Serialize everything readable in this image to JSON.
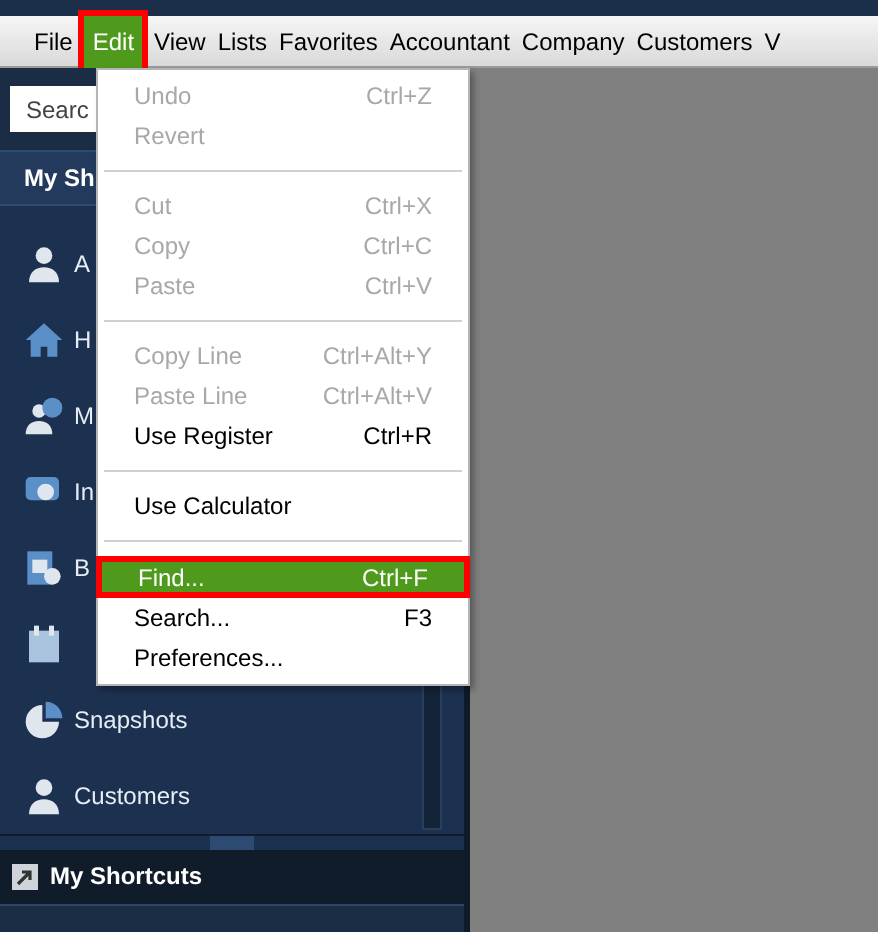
{
  "menu_bar": [
    {
      "label": "File",
      "selected": false
    },
    {
      "label": "Edit",
      "selected": true
    },
    {
      "label": "View",
      "selected": false
    },
    {
      "label": "Lists",
      "selected": false
    },
    {
      "label": "Favorites",
      "selected": false
    },
    {
      "label": "Accountant",
      "selected": false
    },
    {
      "label": "Company",
      "selected": false
    },
    {
      "label": "Customers",
      "selected": false
    },
    {
      "label": "V",
      "selected": false
    }
  ],
  "sidebar": {
    "search": {
      "placeholder": "Searc"
    },
    "header": "My Sh",
    "items": [
      {
        "kind": "person",
        "label": "A"
      },
      {
        "kind": "home",
        "label": "H"
      },
      {
        "kind": "badge-person",
        "label": "M"
      },
      {
        "kind": "chat",
        "label": "In"
      },
      {
        "kind": "document",
        "label": "B"
      },
      {
        "kind": "calendar"
      },
      {
        "kind": "pie",
        "label": "Snapshots"
      },
      {
        "kind": "person",
        "label": "Customers"
      }
    ],
    "footer": "My Shortcuts"
  },
  "edit_menu": [
    {
      "kind": "item",
      "label": "Undo",
      "shortcut": "Ctrl+Z",
      "disabled": true,
      "selected": false
    },
    {
      "kind": "item",
      "label": "Revert",
      "disabled": true,
      "selected": false
    },
    {
      "kind": "separator"
    },
    {
      "kind": "item",
      "label": "Cut",
      "shortcut": "Ctrl+X",
      "disabled": true,
      "selected": false
    },
    {
      "kind": "item",
      "label": "Copy",
      "shortcut": "Ctrl+C",
      "disabled": true,
      "selected": false
    },
    {
      "kind": "item",
      "label": "Paste",
      "shortcut": "Ctrl+V",
      "disabled": true,
      "selected": false
    },
    {
      "kind": "separator"
    },
    {
      "kind": "item",
      "label": "Copy Line",
      "shortcut": "Ctrl+Alt+Y",
      "disabled": true,
      "selected": false
    },
    {
      "kind": "item",
      "label": "Paste Line",
      "shortcut": "Ctrl+Alt+V",
      "disabled": true,
      "selected": false
    },
    {
      "kind": "item",
      "label": "Use Register",
      "shortcut": "Ctrl+R",
      "disabled": false,
      "selected": false
    },
    {
      "kind": "separator"
    },
    {
      "kind": "item",
      "label": "Use Calculator",
      "disabled": false,
      "selected": false
    },
    {
      "kind": "separator"
    },
    {
      "kind": "item",
      "label": "Find...",
      "shortcut": "Ctrl+F",
      "disabled": false,
      "selected": true
    },
    {
      "kind": "item",
      "label": "Search...",
      "shortcut": "F3",
      "disabled": false,
      "selected": false
    },
    {
      "kind": "item",
      "label": "Preferences...",
      "disabled": false,
      "selected": false
    }
  ]
}
